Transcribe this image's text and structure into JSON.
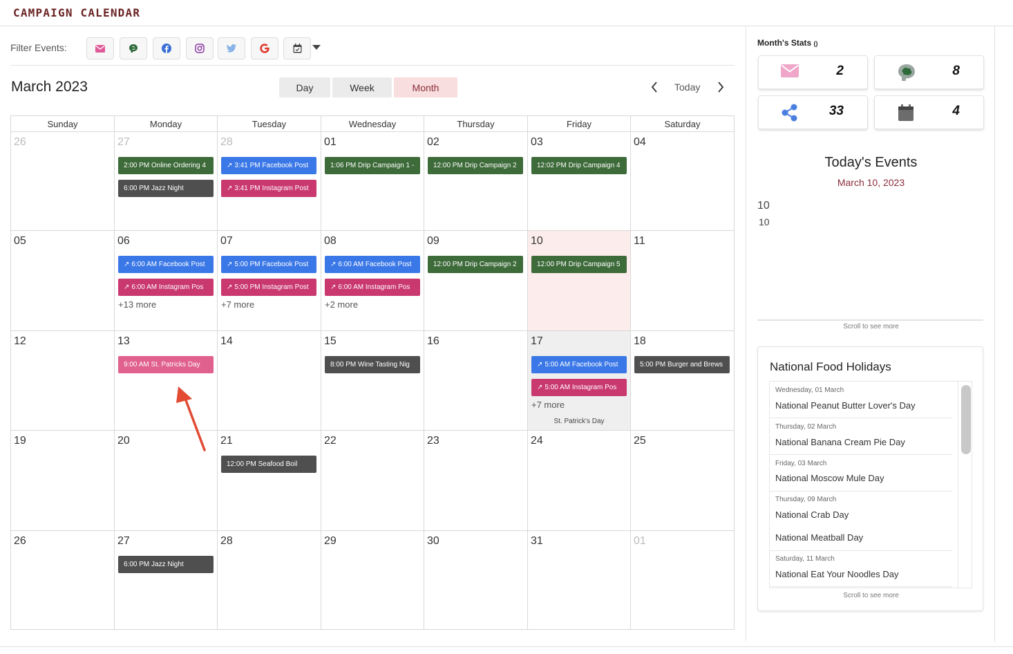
{
  "header": {
    "title": "CAMPAIGN CALENDAR"
  },
  "filter": {
    "label": "Filter Events:",
    "buttons": [
      {
        "icon": "email-icon",
        "color": "#e05a9a"
      },
      {
        "icon": "brain-icon",
        "color": "#2f6b3a"
      },
      {
        "icon": "facebook-icon",
        "color": "#3b6fd6"
      },
      {
        "icon": "instagram-icon",
        "color": "#8a3aa0"
      },
      {
        "icon": "twitter-icon",
        "color": "#8ab3e8"
      },
      {
        "icon": "google-icon",
        "color": "#e03a2e"
      },
      {
        "icon": "calendar-icon",
        "color": "#444444"
      }
    ]
  },
  "toolbar": {
    "month_title": "March 2023",
    "day": "Day",
    "week": "Week",
    "month": "Month",
    "today": "Today"
  },
  "calendar": {
    "weekdays": [
      "Sunday",
      "Monday",
      "Tuesday",
      "Wednesday",
      "Thursday",
      "Friday",
      "Saturday"
    ],
    "weeks": [
      [
        {
          "d": "26",
          "other": true
        },
        {
          "d": "27",
          "other": true,
          "events": [
            {
              "t": "2:00 PM Online Ordering 4",
              "c": "green"
            },
            {
              "t": "6:00 PM Jazz Night",
              "c": "dark"
            }
          ]
        },
        {
          "d": "28",
          "other": true,
          "events": [
            {
              "t": "3:41 PM Facebook Post",
              "c": "blue",
              "link": true
            },
            {
              "t": "3:41 PM Instagram Post",
              "c": "pink",
              "link": true
            }
          ]
        },
        {
          "d": "01",
          "events": [
            {
              "t": "1:06 PM Drip Campaign 1 -",
              "c": "green"
            }
          ]
        },
        {
          "d": "02",
          "events": [
            {
              "t": "12:00 PM Drip Campaign 2",
              "c": "green"
            }
          ]
        },
        {
          "d": "03",
          "events": [
            {
              "t": "12:02 PM Drip Campaign 4",
              "c": "green"
            }
          ]
        },
        {
          "d": "04"
        }
      ],
      [
        {
          "d": "05"
        },
        {
          "d": "06",
          "events": [
            {
              "t": "6:00 AM Facebook Post",
              "c": "blue",
              "link": true
            },
            {
              "t": "6:00 AM Instagram Pos",
              "c": "pink",
              "link": true
            }
          ],
          "more": "+13 more"
        },
        {
          "d": "07",
          "events": [
            {
              "t": "5:00 PM Facebook Post",
              "c": "blue",
              "link": true
            },
            {
              "t": "5:00 PM Instagram Post",
              "c": "pink",
              "link": true
            }
          ],
          "more": "+7 more"
        },
        {
          "d": "08",
          "events": [
            {
              "t": "6:00 AM Facebook Post",
              "c": "blue",
              "link": true
            },
            {
              "t": "6:00 AM Instagram Pos",
              "c": "pink",
              "link": true
            }
          ],
          "more": "+2 more"
        },
        {
          "d": "09",
          "events": [
            {
              "t": "12:00 PM Drip Campaign 2",
              "c": "green"
            }
          ]
        },
        {
          "d": "10",
          "today": true,
          "events": [
            {
              "t": "12:00 PM Drip Campaign 5",
              "c": "green"
            }
          ]
        },
        {
          "d": "11"
        }
      ],
      [
        {
          "d": "12"
        },
        {
          "d": "13",
          "events": [
            {
              "t": "9:00 AM St. Patricks Day",
              "c": "lightpink"
            }
          ]
        },
        {
          "d": "14"
        },
        {
          "d": "15",
          "events": [
            {
              "t": "8:00 PM Wine Tasting Nig",
              "c": "dark"
            }
          ]
        },
        {
          "d": "16"
        },
        {
          "d": "17",
          "shaded": true,
          "events": [
            {
              "t": "5:00 AM Facebook Post",
              "c": "blue",
              "link": true
            },
            {
              "t": "5:00 AM Instagram Pos",
              "c": "pink",
              "link": true
            }
          ],
          "more": "+7 more",
          "holiday": "St. Patrick's Day"
        },
        {
          "d": "18",
          "events": [
            {
              "t": "5:00 PM Burger and Brews",
              "c": "dark"
            }
          ]
        }
      ],
      [
        {
          "d": "19"
        },
        {
          "d": "20"
        },
        {
          "d": "21",
          "events": [
            {
              "t": "12:00 PM Seafood Boil",
              "c": "dark"
            }
          ]
        },
        {
          "d": "22"
        },
        {
          "d": "23"
        },
        {
          "d": "24"
        },
        {
          "d": "25"
        }
      ],
      [
        {
          "d": "26"
        },
        {
          "d": "27",
          "events": [
            {
              "t": "6:00 PM Jazz Night",
              "c": "dark"
            }
          ]
        },
        {
          "d": "28"
        },
        {
          "d": "29"
        },
        {
          "d": "30"
        },
        {
          "d": "31"
        },
        {
          "d": "01",
          "other": true
        }
      ]
    ]
  },
  "colors": {
    "green": "#3e6b3a",
    "dark": "#4f4f4f",
    "blue": "#3b78e7",
    "pink": "#c9386f",
    "lightpink": "#e0608e",
    "accent": "#8a2c3a",
    "today_bg": "#fdecec"
  },
  "stats": {
    "title": "Month's Stats",
    "suffix": "()",
    "cards": [
      {
        "icon": "email-icon",
        "value": "2"
      },
      {
        "icon": "brain-icon",
        "value": "8"
      },
      {
        "icon": "share-icon",
        "value": "33"
      },
      {
        "icon": "calendar-icon",
        "value": "4"
      }
    ]
  },
  "todays_events": {
    "title": "Today's Events",
    "date": "March 10, 2023",
    "line1": "10",
    "line2": "10",
    "scroll_hint": "Scroll to see more"
  },
  "food_holidays": {
    "title": "National Food Holidays",
    "items": [
      {
        "date": "Wednesday, 01 March",
        "name": "National Peanut Butter Lover's Day"
      },
      {
        "date": "Thursday, 02 March",
        "name": "National Banana Cream Pie Day"
      },
      {
        "date": "Friday, 03 March",
        "name": "National Moscow Mule Day"
      },
      {
        "date": "Thursday, 09 March",
        "name": "National Crab Day"
      },
      {
        "date": "",
        "name": "National Meatball Day"
      },
      {
        "date": "Saturday, 11 March",
        "name": "National Eat Your Noodles Day"
      }
    ],
    "scroll_hint": "Scroll to see more"
  }
}
